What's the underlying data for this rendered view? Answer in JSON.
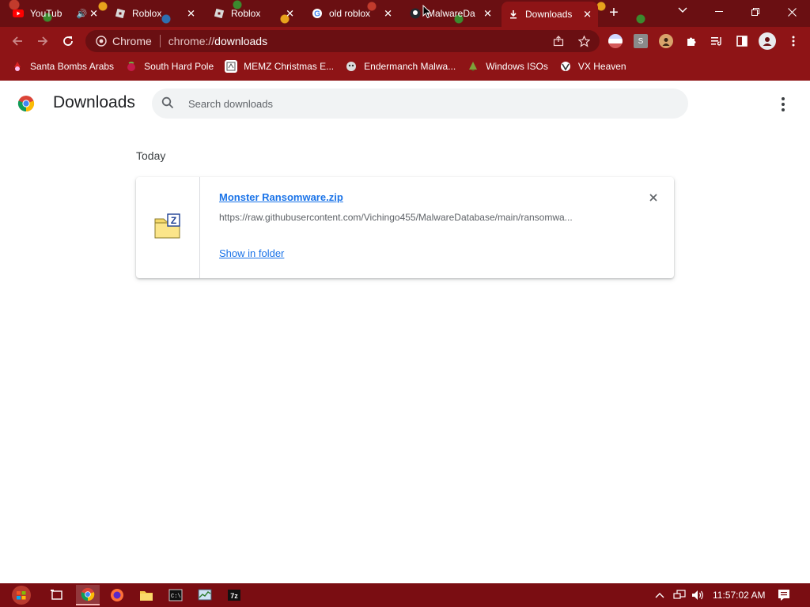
{
  "tabs": [
    {
      "label": "YouTub",
      "favicon": "youtube-icon",
      "has_audio": true
    },
    {
      "label": "Roblox",
      "favicon": "roblox-icon"
    },
    {
      "label": "Roblox",
      "favicon": "roblox-icon"
    },
    {
      "label": "old roblox",
      "favicon": "google-icon"
    },
    {
      "label": "MalwareDa",
      "favicon": "github-icon"
    },
    {
      "label": "Downloads",
      "favicon": "download-icon",
      "active": true
    }
  ],
  "omnibox": {
    "chip": "Chrome",
    "url_scheme": "chrome://",
    "url_host": "downloads"
  },
  "bookmarks": [
    {
      "label": "Santa Bombs Arabs"
    },
    {
      "label": "South Hard Pole"
    },
    {
      "label": "MEMZ Christmas E..."
    },
    {
      "label": "Endermanch Malwa..."
    },
    {
      "label": "Windows ISOs"
    },
    {
      "label": "VX Heaven"
    }
  ],
  "page": {
    "title": "Downloads",
    "search_placeholder": "Search downloads"
  },
  "downloads": {
    "date_header": "Today",
    "items": [
      {
        "file_name": "Monster Ransomware.zip",
        "url": "https://raw.githubusercontent.com/Vichingo455/MalwareDatabase/main/ransomwa...",
        "action": "Show in folder"
      }
    ]
  },
  "taskbar": {
    "clock": "11:57:02 AM"
  },
  "colors": {
    "frame": "#8e1416",
    "tabstrip": "#6a0f12",
    "link": "#1a73e8",
    "taskbar": "#7a0d12"
  }
}
